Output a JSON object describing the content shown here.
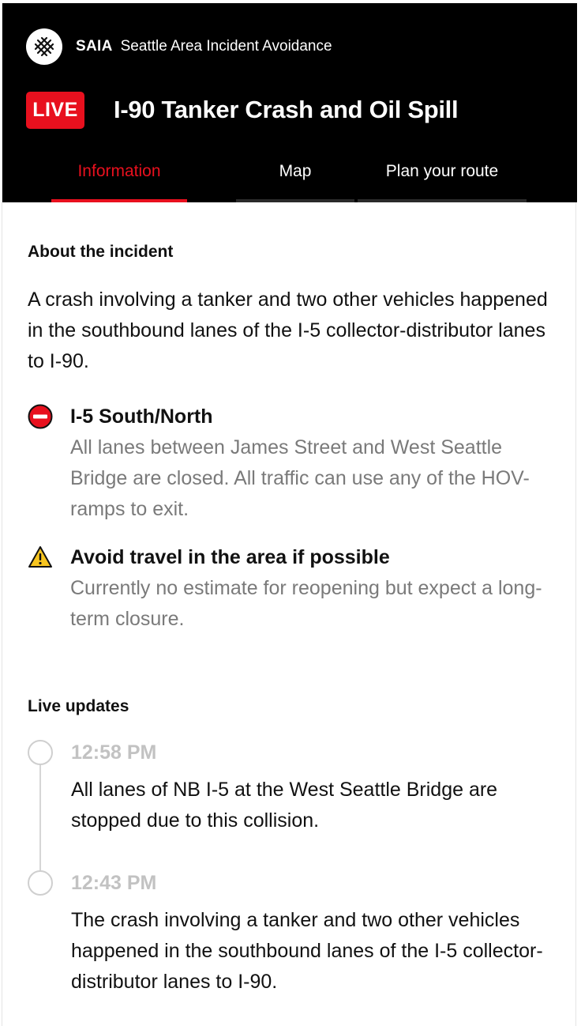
{
  "brand": {
    "short": "SAIA",
    "long": "Seattle Area Incident Avoidance"
  },
  "header": {
    "badge": "LIVE",
    "title": "I-90 Tanker Crash and Oil Spill",
    "accent_color": "#e8101e"
  },
  "tabs": [
    {
      "label": "Information",
      "active": true
    },
    {
      "label": "Map",
      "active": false
    },
    {
      "label": "Plan your route",
      "active": false
    }
  ],
  "about": {
    "heading": "About the incident",
    "text": "A crash involving a tanker and two other vehicles happened in the southbound lanes of the I-5 collector-distributor lanes to I-90."
  },
  "alerts": [
    {
      "icon": "no-entry-icon",
      "title": "I-5 South/North",
      "description": "All lanes between James Street and West Seattle Bridge are closed. All traffic can use any of the HOV-ramps to exit."
    },
    {
      "icon": "warning-icon",
      "title": "Avoid travel in the area if possible",
      "description": "Currently no estimate for reopening but expect a long-term closure."
    }
  ],
  "updates": {
    "heading": "Live updates",
    "items": [
      {
        "time": "12:58 PM",
        "text": "All lanes of NB I-5 at the West Seattle Bridge are stopped due to this collision."
      },
      {
        "time": "12:43 PM",
        "text": "The crash involving a tanker and two other vehicles happened in the southbound lanes of the I-5 collector-distributor lanes to I-90."
      }
    ]
  }
}
